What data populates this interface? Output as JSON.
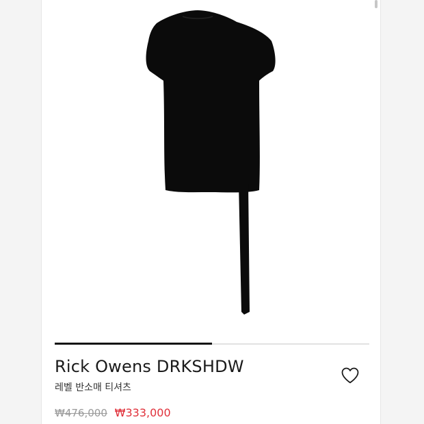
{
  "product": {
    "brand": "Rick Owens DRKSHDW",
    "name": "레벨 반소매 티셔츠",
    "original_price": "₩476,000",
    "sale_price": "₩333,000"
  },
  "carousel": {
    "progress": 0.5
  },
  "icons": {
    "wishlist": "heart-outline-icon",
    "scrollbar": "scrollbar-thumb"
  },
  "colors": {
    "sale_price": "#e0303a",
    "garment": "#0b0b0b",
    "carousel_active": "#111111"
  }
}
